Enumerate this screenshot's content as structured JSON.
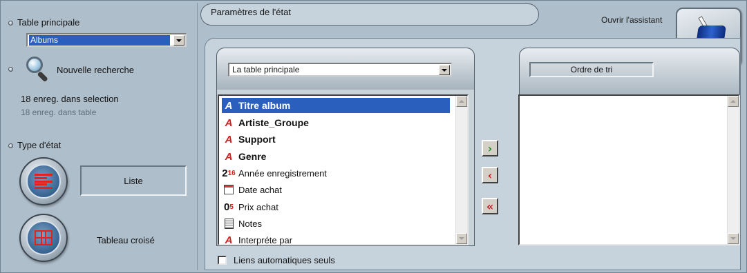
{
  "left": {
    "table_principale_label": "Table principale",
    "table_principale_value": "Albums",
    "nouvelle_recherche_label": "Nouvelle recherche",
    "selection_count": "18 enreg. dans selection",
    "table_count": "18 enreg. dans table",
    "type_etat_label": "Type d'état",
    "liste_label": "Liste",
    "tableau_croise_label": "Tableau croisé"
  },
  "header": {
    "title": "Paramètres de l'état",
    "assistant_label": "Ouvrir l'assistant"
  },
  "fields_panel": {
    "source_dropdown_value": "La table principale",
    "fields": [
      {
        "label": "Titre album",
        "icon": "alpha-field-icon",
        "bold": true,
        "selected": true
      },
      {
        "label": "Artiste_Groupe",
        "icon": "alpha-field-icon",
        "bold": true,
        "selected": false
      },
      {
        "label": "Support",
        "icon": "alpha-field-icon",
        "bold": true,
        "selected": false
      },
      {
        "label": "Genre",
        "icon": "alpha-field-icon",
        "bold": true,
        "selected": false
      },
      {
        "label": "Année enregistrement",
        "icon": "integer-field-icon",
        "bold": false,
        "selected": false
      },
      {
        "label": "Date achat",
        "icon": "date-field-icon",
        "bold": false,
        "selected": false
      },
      {
        "label": "Prix achat",
        "icon": "real-field-icon",
        "bold": false,
        "selected": false
      },
      {
        "label": "Notes",
        "icon": "text-field-icon",
        "bold": false,
        "selected": false
      },
      {
        "label": "Interpréte par",
        "icon": "alpha-field-icon",
        "bold": false,
        "selected": false
      }
    ],
    "integer_icon_glyph": "2",
    "integer_icon_sup": "16",
    "real_icon_glyph": "0",
    "real_icon_sup": "5",
    "alpha_icon_glyph": "A",
    "checkbox_label": "Liens automatiques seuls"
  },
  "move_buttons": {
    "add": "›",
    "remove": "‹",
    "remove_all": "«"
  },
  "sort_panel": {
    "title": "Ordre de tri"
  },
  "colors": {
    "selection": "#2b5fbe",
    "panel_bg": "#aebecb",
    "field_icon_red": "#d42020",
    "arrow_green": "#1f8a1f",
    "arrow_red": "#c8181e"
  }
}
